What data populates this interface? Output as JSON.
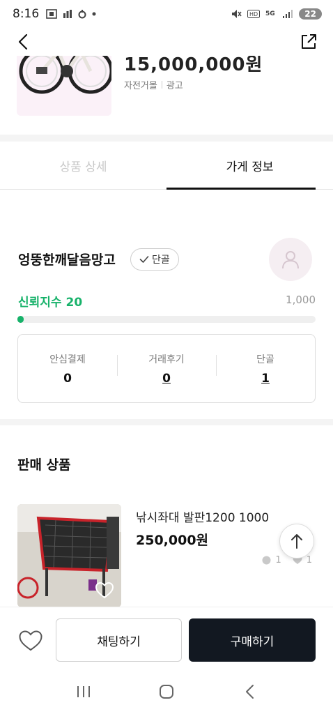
{
  "status_bar": {
    "time": "8:16",
    "battery": "22",
    "icons_left": [
      "screenshot-icon",
      "data-icon",
      "notification-icon",
      "dot-icon"
    ],
    "icons_right": [
      "mute-icon",
      "hd-icon",
      "5g-icon",
      "signal-icon",
      "battery-icon"
    ]
  },
  "header": {
    "back_icon": "chevron-left-icon",
    "share_icon": "share-external-icon"
  },
  "product": {
    "price_partial": "15,000,000원",
    "category": "자전거몰",
    "tag": "광고"
  },
  "tabs": [
    {
      "label": "상품 상세",
      "active": false
    },
    {
      "label": "가게 정보",
      "active": true
    }
  ],
  "store": {
    "name": "엉뚱한깨달음망고",
    "badge": "단골",
    "trust_label": "신뢰지수",
    "trust_value": "20",
    "trust_max": "1,000",
    "trust_fraction": 0.02,
    "stats": [
      {
        "label": "안심결제",
        "value": "0",
        "underlined": false
      },
      {
        "label": "거래후기",
        "value": "0",
        "underlined": true
      },
      {
        "label": "단골",
        "value": "1",
        "underlined": true
      }
    ]
  },
  "sales": {
    "title": "판매 상품",
    "items": [
      {
        "title": "낚시좌대 발판1200 1000",
        "price": "250,000원",
        "chat_count": "1",
        "like_count": "1"
      }
    ]
  },
  "bottom_bar": {
    "chat_label": "채팅하기",
    "buy_label": "구매하기"
  },
  "colors": {
    "accent_green": "#17b26a",
    "buy_button": "#121821",
    "inactive_tab": "#c8c8c8"
  }
}
